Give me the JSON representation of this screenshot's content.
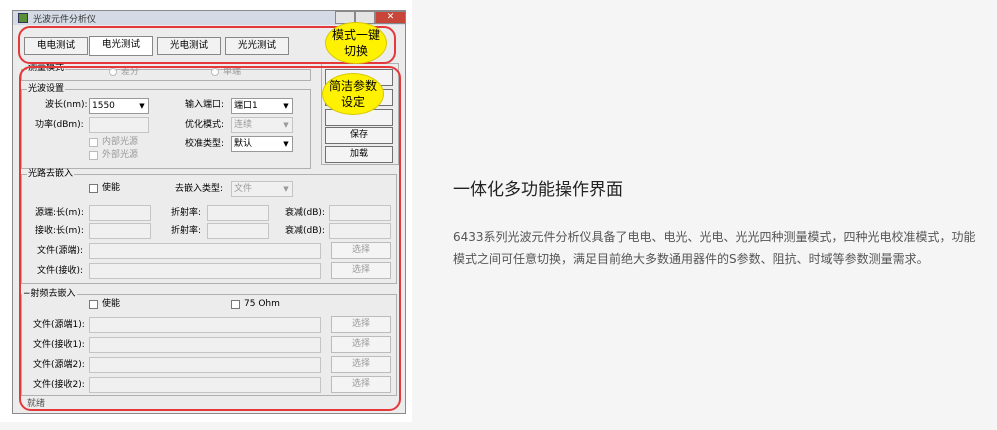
{
  "window": {
    "title": "光波元件分析仪",
    "close_glyph": "✕"
  },
  "tabs": [
    {
      "label": "电电测试",
      "active": false
    },
    {
      "label": "电光测试",
      "active": true
    },
    {
      "label": "光电测试",
      "active": false
    },
    {
      "label": "光光测试",
      "active": false
    }
  ],
  "callouts": {
    "mode_switch": "模式一键切换",
    "params": "简洁参数设定"
  },
  "measure_mode": {
    "group_label": "测量模式",
    "differential": "差分",
    "single_ended": "单端"
  },
  "light_settings": {
    "group_label": "光波设置",
    "wavelength_label": "波长(nm):",
    "wavelength_value": "1550",
    "power_label": "功率(dBm):",
    "power_value": "",
    "internal_source": "内部光源",
    "external_source": "外部光源",
    "input_port_label": "输入端口:",
    "input_port_value": "端口1",
    "optimize_label": "优化模式:",
    "optimize_value": "连续",
    "calib_label": "校准类型:",
    "calib_value": "默认"
  },
  "side_buttons": {
    "save": "保存",
    "load": "加载"
  },
  "optical_deembed": {
    "group_label": "光路去嵌入",
    "enable": "使能",
    "type_label": "去嵌入类型:",
    "type_value": "文件",
    "src_len_label": "源端:长(m):",
    "rcv_len_label": "接收:长(m):",
    "refr_label": "折射率:",
    "atten_label": "衰减(dB):",
    "file_src_label": "文件(源端):",
    "file_rcv_label": "文件(接收):",
    "browse": "选择"
  },
  "rf_deembed": {
    "group_label": "射频去嵌入",
    "collapse_glyph": "−",
    "enable": "使能",
    "ohm75": "75 Ohm",
    "file_src1": "文件(源端1):",
    "file_rcv1": "文件(接收1):",
    "file_src2": "文件(源端2):",
    "file_rcv2": "文件(接收2):",
    "browse": "选择"
  },
  "status": "就绪",
  "side": {
    "title": "一体化多功能操作界面",
    "description": "6433系列光波元件分析仪具备了电电、电光、光电、光光四种测量模式，四种光电校准模式，功能模式之间可任意切换，满足目前绝大多数通用器件的S参数、阻抗、时域等参数测量需求。"
  },
  "colors": {
    "highlight_ring": "#e5383b",
    "callout_fill": "#fff200"
  }
}
